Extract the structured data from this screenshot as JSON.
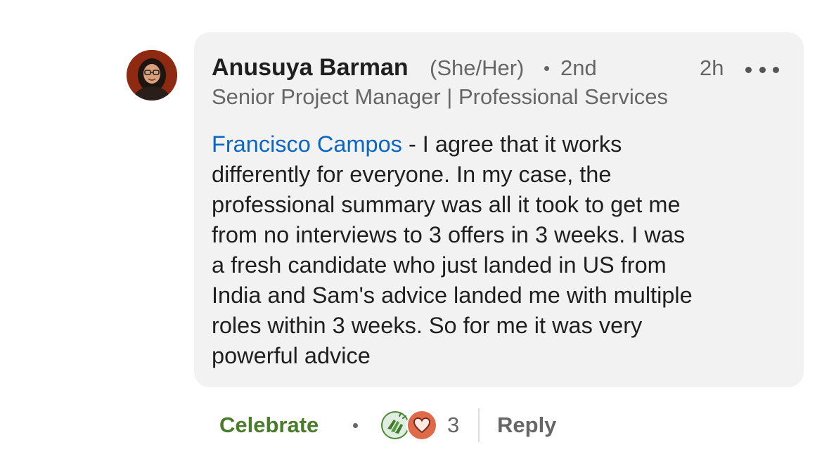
{
  "comment": {
    "author": {
      "name": "Anusuya Barman",
      "pronouns": "(She/Her)",
      "separator": "•",
      "connection_degree": "2nd",
      "headline": "Senior Project Manager | Professional Services",
      "avatar_icon": "profile-photo"
    },
    "timestamp": "2h",
    "more_icon": "ellipsis-horizontal-icon",
    "mention": "Francisco Campos",
    "text_lines": [
      " - I agree that it works",
      "differently for everyone. In my case, the",
      "professional summary was all it took to get me",
      "from no interviews to 3 offers in 3 weeks. I was",
      "a fresh candidate who just landed in US from",
      "India and Sam's advice landed me with multiple",
      "roles within 3 weeks. So for me it was very",
      "powerful advice"
    ]
  },
  "actions": {
    "reaction_label": "Celebrate",
    "separator": "•",
    "reaction_icons": [
      "celebrate-icon",
      "love-icon"
    ],
    "reaction_count": "3",
    "reply_label": "Reply"
  },
  "colors": {
    "bubble_background": "#f2f2f2",
    "mention_link": "#0a66c2",
    "celebrate_green": "#4a7d2b",
    "love_orange": "#de6a4a",
    "secondary_text": "#666666",
    "primary_text": "#1f1f1f"
  }
}
